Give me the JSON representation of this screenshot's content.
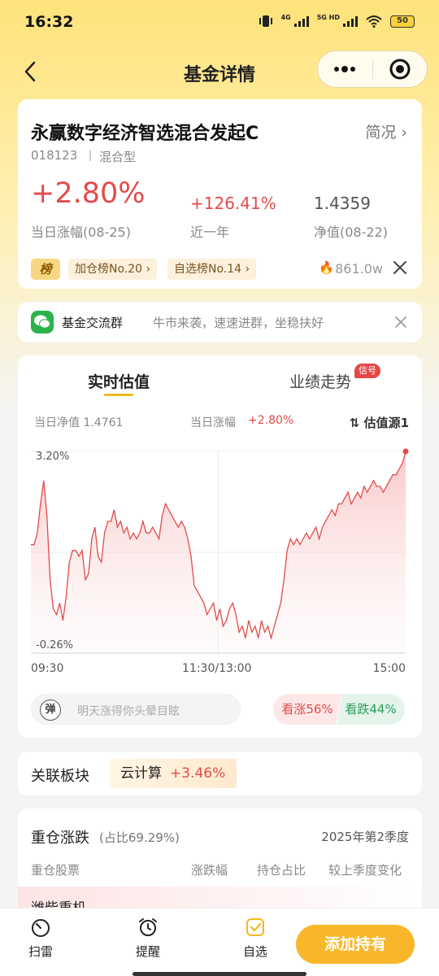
{
  "status_bar": {
    "time": "16:32",
    "signal1": "4G",
    "signal2": "5G HD",
    "battery": "50"
  },
  "nav": {
    "title": "基金详情"
  },
  "fund": {
    "name": "永赢数字经济智选混合发起C",
    "brief_label": "简况",
    "code": "018123",
    "type": "混合型",
    "day_change": "+2.80%",
    "day_change_label": "当日涨幅(08-25)",
    "year_change": "+126.41%",
    "year_change_label": "近一年",
    "nav_value": "1.4359",
    "nav_label": "净值(08-22)",
    "rank_icon": "榜",
    "rank_chips": [
      "加仓榜No.20",
      "自选榜No.14"
    ],
    "heat": "861.0w"
  },
  "group": {
    "title": "基金交流群",
    "desc": "牛市来袭，速速进群，坐稳扶好"
  },
  "chart_card": {
    "tabs": [
      "实时估值",
      "业绩走势"
    ],
    "badge": "信号",
    "est_nav": "当日净值 1.4761",
    "est_change_label": "当日涨幅",
    "est_change": "+2.80%",
    "est_source": "估值源1",
    "time_labels": [
      "09:30",
      "11:30/13:00",
      "15:00"
    ],
    "danmu_icon": "弹",
    "danmu_placeholder": "明天涨得你头晕目眩",
    "vote_up": "看涨56%",
    "vote_down": "看跌44%"
  },
  "chart_data": {
    "type": "area",
    "ylim": [
      -0.26,
      3.2
    ],
    "y_tick_labels": [
      "3.20%",
      "-0.26%"
    ],
    "x_tick_labels": [
      "09:30",
      "11:30/13:00",
      "15:00"
    ],
    "grid": true,
    "color": "#e34b4b",
    "values": [
      1.6,
      1.6,
      1.8,
      2.3,
      2.7,
      2.1,
      1.0,
      0.5,
      0.4,
      0.6,
      0.3,
      0.7,
      1.3,
      1.5,
      1.5,
      1.4,
      1.5,
      1.0,
      1.1,
      1.7,
      1.9,
      1.4,
      1.3,
      1.8,
      2.0,
      2.0,
      2.2,
      1.9,
      2.0,
      1.8,
      1.9,
      1.7,
      1.8,
      1.7,
      1.8,
      2.0,
      1.8,
      1.8,
      1.9,
      1.8,
      1.7,
      2.1,
      2.3,
      2.2,
      2.1,
      2.0,
      1.9,
      2.0,
      1.9,
      1.7,
      1.4,
      0.9,
      0.8,
      0.7,
      0.6,
      0.4,
      0.5,
      0.6,
      0.3,
      0.5,
      0.2,
      0.3,
      0.5,
      0.6,
      0.4,
      0.1,
      0.2,
      0.0,
      0.3,
      0.1,
      0.2,
      0.0,
      0.3,
      0.1,
      0.2,
      0.0,
      0.2,
      0.4,
      0.6,
      1.0,
      1.5,
      1.7,
      1.6,
      1.7,
      1.6,
      1.7,
      1.8,
      1.7,
      1.8,
      1.9,
      1.7,
      1.9,
      2.0,
      2.1,
      2.2,
      2.1,
      2.3,
      2.3,
      2.4,
      2.5,
      2.3,
      2.4,
      2.5,
      2.4,
      2.6,
      2.5,
      2.6,
      2.7,
      2.6,
      2.6,
      2.5,
      2.6,
      2.7,
      2.8,
      2.8,
      2.9,
      3.0,
      3.2
    ]
  },
  "sector": {
    "title": "关联板块",
    "name": "云计算",
    "change": "+3.46%"
  },
  "holdings": {
    "title": "重仓涨跌",
    "ratio": "(占比69.29%)",
    "quarter": "2025年第2季度",
    "headers": [
      "重仓股票",
      "涨跌幅",
      "持仓占比",
      "较上季度变化"
    ],
    "first_row_name": "潍柴重机"
  },
  "tabbar": {
    "items": [
      "扫雷",
      "提醒",
      "自选"
    ],
    "add_label": "添加持有"
  }
}
